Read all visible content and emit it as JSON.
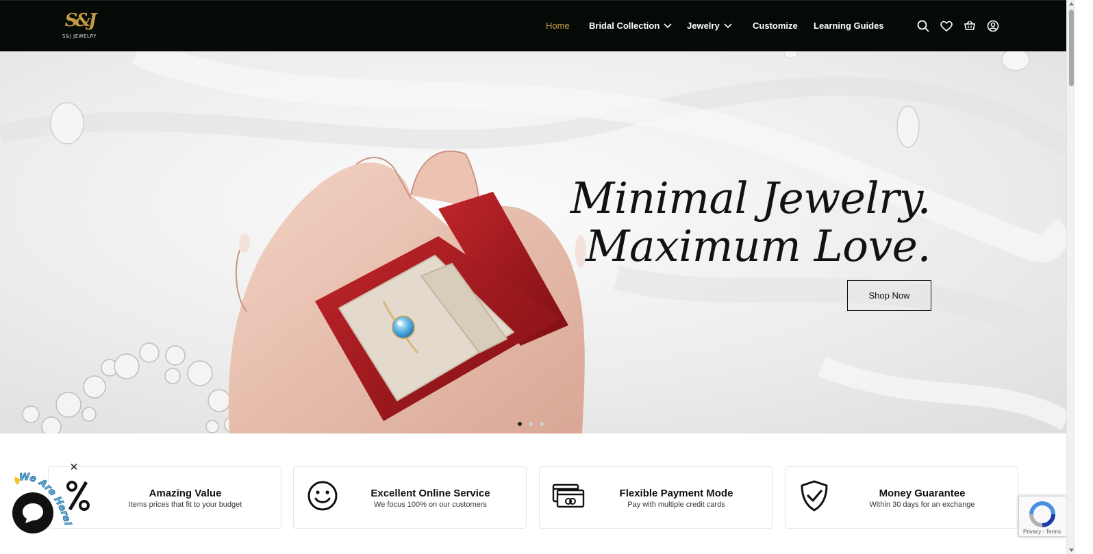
{
  "brand": {
    "logo_mark": "S&J",
    "logo_text": "S&J JEWELRY"
  },
  "nav": {
    "home": "Home",
    "bridal": "Bridal Collection",
    "jewelry": "Jewelry",
    "customize": "Customize",
    "guides": "Learning Guides"
  },
  "hero": {
    "line1": "Minimal Jewelry.",
    "line2": "Maximum Love.",
    "cta": "Shop Now",
    "slide_count": 3,
    "active_slide": 1
  },
  "features": [
    {
      "icon": "percent-icon",
      "title": "Amazing Value",
      "desc": "Items prices that fit to your budget"
    },
    {
      "icon": "smiley-icon",
      "title": "Excellent Online Service",
      "desc": "We focus 100% on our customers"
    },
    {
      "icon": "credit-cards-icon",
      "title": "Flexible Payment Mode",
      "desc": "Pay with multiple credit cards"
    },
    {
      "icon": "shield-check-icon",
      "title": "Money Guarantee",
      "desc": "Within 30 days for an exchange"
    }
  ],
  "widgets": {
    "chat_badge": "We Are Here!",
    "close_symbol": "✕",
    "recaptcha_links": "Privacy - Terms"
  },
  "colors": {
    "nav_bg": "#050a06",
    "accent_gold": "#c9a14a",
    "box_red": "#a3151b"
  }
}
